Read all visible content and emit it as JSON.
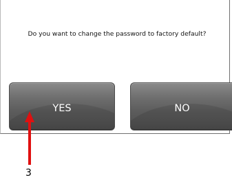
{
  "dialog": {
    "message": "Do you want to change the password to factory default?",
    "yes_label": "YES",
    "no_label": "NO"
  },
  "annotation": {
    "label": "3",
    "arrow_color": "#e01010"
  },
  "colors": {
    "button": "#5c5c5c",
    "button_text": "#ffffff"
  }
}
